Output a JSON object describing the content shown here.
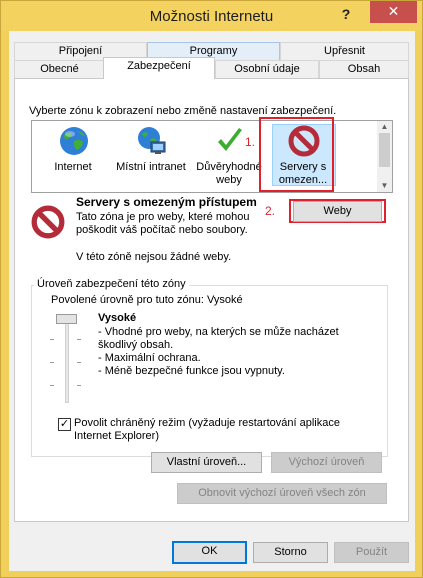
{
  "window": {
    "title": "Možnosti Internetu",
    "help": "?",
    "close": "✕"
  },
  "tabs": {
    "row1": [
      "Připojení",
      "Programy",
      "Upřesnit"
    ],
    "row2": [
      "Obecné",
      "Zabezpečení",
      "Osobní údaje",
      "Obsah"
    ],
    "active": "Zabezpečení"
  },
  "zones": {
    "prompt": "Vyberte zónu k zobrazení nebo změně nastavení zabezpečení.",
    "items": [
      {
        "label": "Internet",
        "icon": "globe-icon"
      },
      {
        "label": "Místní intranet",
        "icon": "intranet-icon"
      },
      {
        "label": "Důvěryhodné weby",
        "icon": "checkmark-icon"
      },
      {
        "label": "Servery s omezen...",
        "icon": "restricted-icon",
        "selected": true
      }
    ]
  },
  "annotations": {
    "one": "1.",
    "two": "2."
  },
  "zone_info": {
    "heading": "Servery s omezeným přístupem",
    "description": "Tato zóna je pro weby, které mohou poškodit váš počítač nebo soubory.",
    "no_sites": "V této zóně nejsou žádné weby.",
    "sites_button": "Weby"
  },
  "security_level": {
    "group_title": "Úroveň zabezpečení této zóny",
    "allowed": "Povolené úrovně pro tuto zónu: Vysoké",
    "level": "Vysoké",
    "bullets": [
      "- Vhodné pro weby, na kterých se může nacházet škodlivý obsah.",
      "- Maximální ochrana.",
      "- Méně bezpečné funkce jsou vypnuty."
    ],
    "protected_mode": "Povolit chráněný režim (vyžaduje restartování aplikace Internet Explorer)",
    "protected_mode_checked": true,
    "custom_level": "Vlastní úroveň...",
    "default_level": "Výchozí úroveň",
    "reset_all": "Obnovit výchozí úroveň všech zón"
  },
  "footer": {
    "ok": "OK",
    "cancel": "Storno",
    "apply": "Použít"
  },
  "colors": {
    "titlebar": "#f3d25f",
    "close": "#c7504d",
    "highlight_box": "#e0202a",
    "selection": "#cce8ff"
  }
}
